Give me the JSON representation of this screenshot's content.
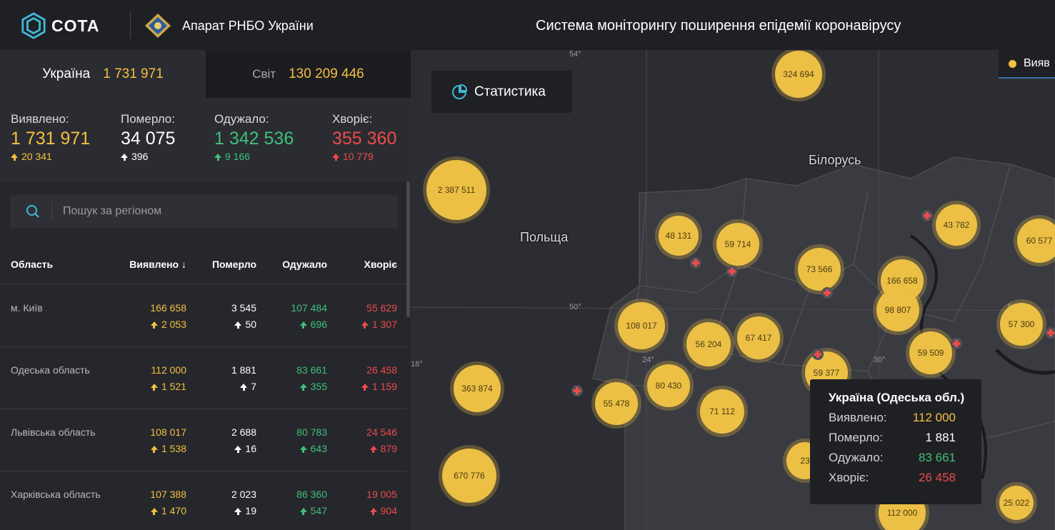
{
  "header": {
    "logo_text": "COTA",
    "org_name": "Апарат РНБО України",
    "system_title": "Система моніторингу поширення епідемії коронавірусу"
  },
  "tabs": {
    "ukraine": {
      "label": "Україна",
      "value": "1 731 971"
    },
    "world": {
      "label": "Світ",
      "value": "130 209 446"
    }
  },
  "stats": {
    "detected": {
      "label": "Виявлено:",
      "value": "1 731 971",
      "delta": "20 341"
    },
    "died": {
      "label": "Померло:",
      "value": "34 075",
      "delta": "396"
    },
    "recovered": {
      "label": "Одужало:",
      "value": "1 342 536",
      "delta": "9 166"
    },
    "sick": {
      "label": "Хворіє:",
      "value": "355 360",
      "delta": "10 779"
    }
  },
  "search": {
    "placeholder": "Пошук за регіоном"
  },
  "table": {
    "headers": {
      "region": "Область",
      "detected": "Виявлено ↓",
      "died": "Померло",
      "recovered": "Одужало",
      "sick": "Хворіє"
    },
    "rows": [
      {
        "region": "м. Київ",
        "detected": "166 658",
        "detected_d": "2 053",
        "died": "3 545",
        "died_d": "50",
        "recovered": "107 484",
        "recovered_d": "696",
        "sick": "55 629",
        "sick_d": "1 307"
      },
      {
        "region": "Одеська область",
        "detected": "112 000",
        "detected_d": "1 521",
        "died": "1 881",
        "died_d": "7",
        "recovered": "83 661",
        "recovered_d": "355",
        "sick": "26 458",
        "sick_d": "1 159"
      },
      {
        "region": "Львівська область",
        "detected": "108 017",
        "detected_d": "1 538",
        "died": "2 688",
        "died_d": "16",
        "recovered": "80 783",
        "recovered_d": "643",
        "sick": "24 546",
        "sick_d": "879"
      },
      {
        "region": "Харківська область",
        "detected": "107 388",
        "detected_d": "1 470",
        "died": "2 023",
        "died_d": "19",
        "recovered": "86 360",
        "recovered_d": "547",
        "sick": "19 005",
        "sick_d": "904"
      }
    ]
  },
  "map": {
    "stat_button": "Статистика",
    "legend": "Вияв",
    "countries": {
      "poland": "Польща",
      "belarus": "Білорусь"
    },
    "coords": {
      "lat54": "54°",
      "lat50": "50°",
      "lat50b": "50°",
      "lon24": "24°",
      "lon30": "30°",
      "lon18": "18°"
    },
    "bubbles": [
      "324 694",
      "2 387 511",
      "48 131",
      "59 714",
      "73 566",
      "166 658",
      "43 782",
      "60 577",
      "98 807",
      "108 017",
      "56 204",
      "67 417",
      "59 509",
      "57 300",
      "59 377",
      "363 874",
      "80 430",
      "55 478",
      "71 112",
      "670 776",
      "23",
      "112 000",
      "25 022"
    ],
    "tooltip": {
      "title": "Україна (Одеська обл.)",
      "detected_label": "Виявлено:",
      "detected": "112 000",
      "died_label": "Померло:",
      "died": "1 881",
      "recovered_label": "Одужало:",
      "recovered": "83 661",
      "sick_label": "Хворіє:",
      "sick": "26 458"
    }
  },
  "colors": {
    "yellow": "#f3c13f",
    "green": "#3fc07a",
    "red": "#ec4b4b",
    "accent": "#3fb8d6"
  }
}
